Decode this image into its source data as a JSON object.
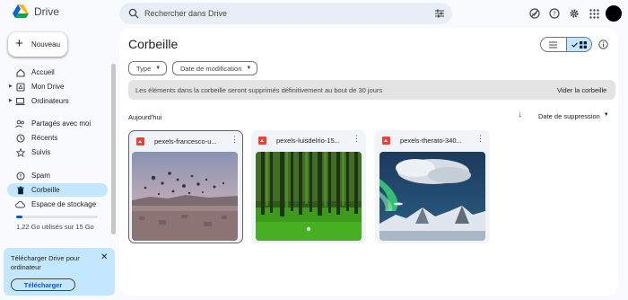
{
  "app": {
    "name": "Drive"
  },
  "search": {
    "placeholder": "Rechercher dans Drive"
  },
  "header_icons": [
    "offline-status-icon",
    "help-icon",
    "settings-icon",
    "apps-grid-icon"
  ],
  "new_button": {
    "label": "Nouveau"
  },
  "sidebar": {
    "items": [
      {
        "label": "Accueil",
        "icon": "home-icon"
      },
      {
        "label": "Mon Drive",
        "icon": "my-drive-icon"
      },
      {
        "label": "Ordinateurs",
        "icon": "computer-icon"
      },
      {
        "label": "Partagés avec moi",
        "icon": "shared-icon"
      },
      {
        "label": "Récents",
        "icon": "clock-icon"
      },
      {
        "label": "Suivis",
        "icon": "star-icon"
      },
      {
        "label": "Spam",
        "icon": "spam-icon"
      },
      {
        "label": "Corbeille",
        "icon": "trash-icon",
        "active": true
      },
      {
        "label": "Espace de stockage",
        "icon": "cloud-icon"
      }
    ],
    "storage": {
      "text": "1,22 Go utilisés sur 15 Go",
      "fraction": 0.081
    }
  },
  "promo": {
    "text": "Télécharger Drive pour ordinateur",
    "button": "Télécharger"
  },
  "main": {
    "title": "Corbeille",
    "filters": [
      {
        "label": "Type"
      },
      {
        "label": "Date de modification"
      }
    ],
    "banner": {
      "text": "Les éléments dans la corbeille seront supprimés définitivement au bout de 30 jours",
      "action": "Vider la corbeille"
    },
    "section": "Aujourd'hui",
    "sort": {
      "label": "Date de suppression"
    },
    "files": [
      {
        "name": "pexels-francesco-u...",
        "thumbnail": "hot-air-balloons-over-valley",
        "selected": true
      },
      {
        "name": "pexels-luisdelrio-15...",
        "thumbnail": "green-forest-trees",
        "selected": false
      },
      {
        "name": "pexels-therato-340...",
        "thumbnail": "aurora-snowy-mountains",
        "selected": false
      }
    ]
  },
  "colors": {
    "accent": "#0b57d0",
    "active_nav": "#c2e7ff",
    "surface": "#f8fafd",
    "file_icon": "#ea4335"
  }
}
